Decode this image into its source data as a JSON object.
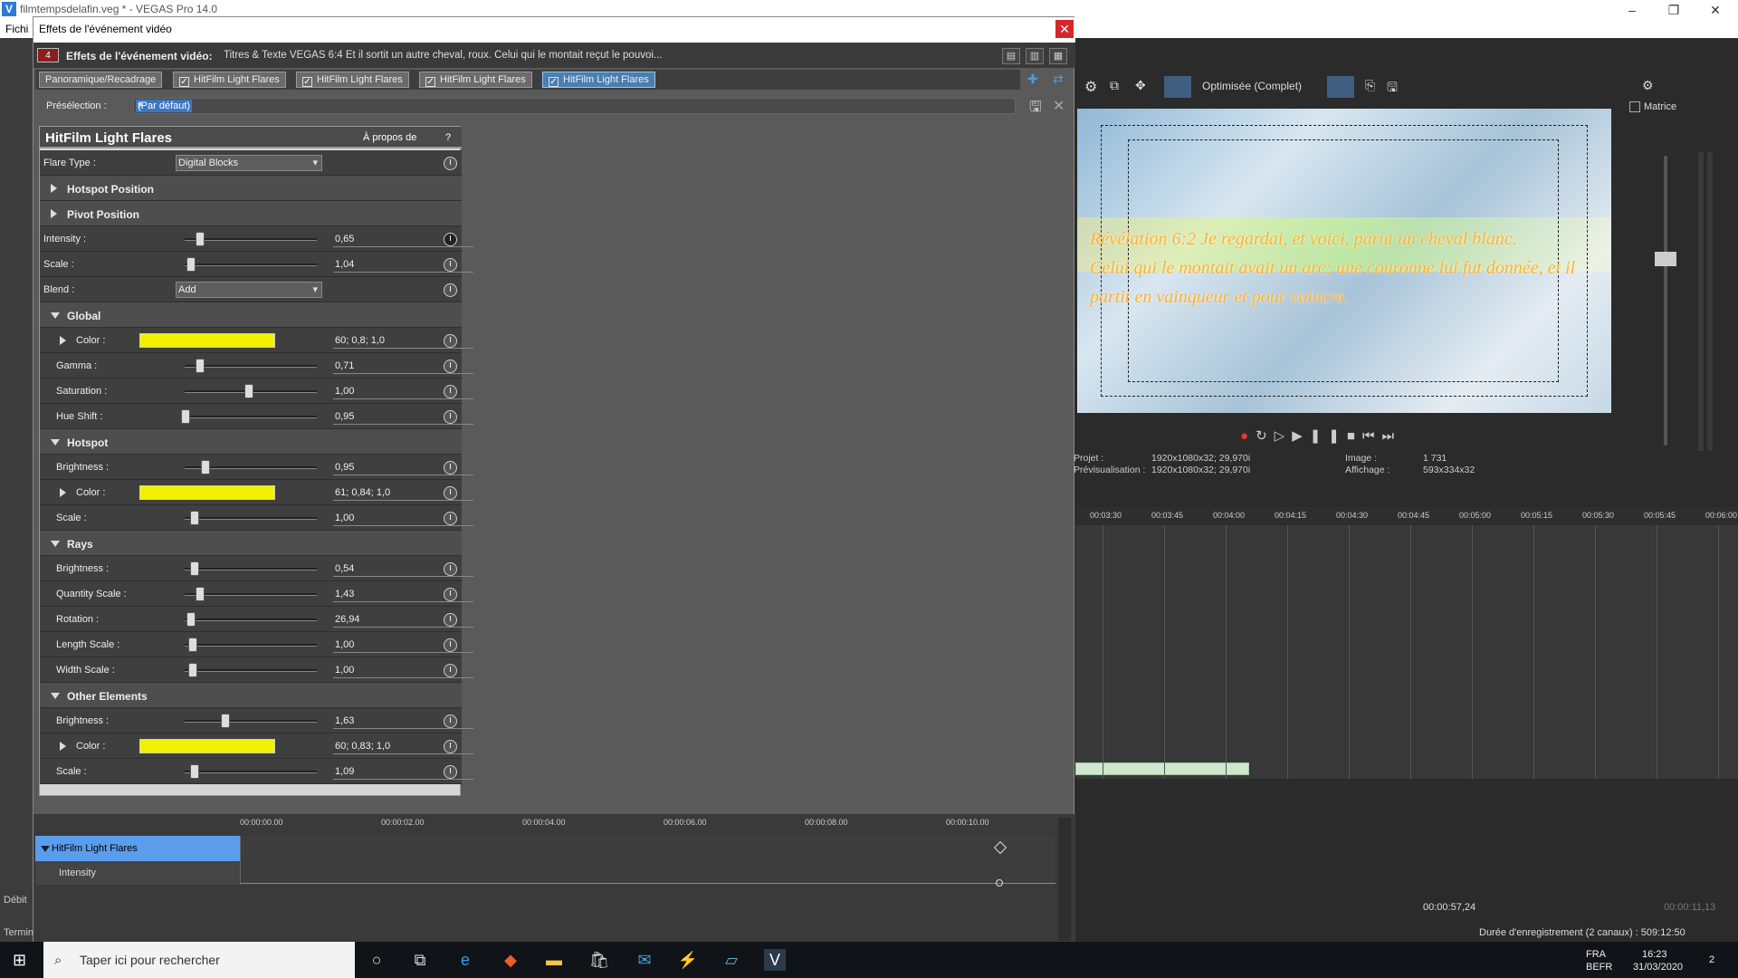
{
  "window": {
    "title": "filmtempsdelafin.veg * - VEGAS Pro 14.0",
    "menu_first": "Fichi"
  },
  "dialog": {
    "title": "Effets de l'événement vidéo",
    "fx_badge": "4",
    "header_label": "Effets de l'événement vidéo:",
    "header_desc": "Titres & Texte VEGAS 6:4 Et il sortit un autre cheval, roux. Celui qui le montait reçut le pouvoi...",
    "chain": [
      "Panoramique/Recadrage",
      "HitFilm Light Flares",
      "HitFilm Light Flares",
      "HitFilm Light Flares",
      "HitFilm Light Flares"
    ],
    "preset_label": "Présélection :",
    "preset_value": "(Par défaut)"
  },
  "plugin": {
    "title": "HitFilm Light Flares",
    "about": "À propos de",
    "help": "?",
    "flare_type_label": "Flare Type :",
    "flare_type_value": "Digital Blocks",
    "hotspot_position": "Hotspot Position",
    "pivot_position": "Pivot Position",
    "intensity_label": "Intensity :",
    "intensity_value": "0,65",
    "scale_label": "Scale :",
    "scale_value": "1,04",
    "blend_label": "Blend :",
    "blend_value": "Add",
    "global": {
      "title": "Global",
      "color_label": "Color :",
      "color_value": "60; 0,8; 1,0",
      "gamma_label": "Gamma :",
      "gamma_value": "0,71",
      "saturation_label": "Saturation :",
      "saturation_value": "1,00",
      "hue_label": "Hue Shift :",
      "hue_value": "0,95"
    },
    "hotspot": {
      "title": "Hotspot",
      "brightness_label": "Brightness :",
      "brightness_value": "0,95",
      "color_label": "Color :",
      "color_value": "61; 0,84; 1,0",
      "scale_label": "Scale :",
      "scale_value": "1,00"
    },
    "rays": {
      "title": "Rays",
      "brightness_label": "Brightness :",
      "brightness_value": "0,54",
      "quantity_label": "Quantity Scale :",
      "quantity_value": "1,43",
      "rotation_label": "Rotation :",
      "rotation_value": "26,94",
      "length_label": "Length Scale :",
      "length_value": "1,00",
      "width_label": "Width Scale :",
      "width_value": "1,00"
    },
    "other": {
      "title": "Other Elements",
      "brightness_label": "Brightness :",
      "brightness_value": "1,63",
      "color_label": "Color :",
      "color_value": "60; 0,83; 1,0",
      "scale_label": "Scale :",
      "scale_value": "1,09"
    },
    "swatch_color": "#f2f200"
  },
  "keyframes": {
    "ticks": [
      "00:00:00.00",
      "00:00:02.00",
      "00:00:04.00",
      "00:00:06.00",
      "00:00:08.00",
      "00:00:10.00"
    ],
    "track": "HitFilm Light Flares",
    "param": "Intensity"
  },
  "preview": {
    "quality": "Optimisée (Complet)",
    "verse": "Révélation 6:2 Je regardai, et voici, parut un cheval blanc.\nCelui qui le montait avait un arc; une couronne lui fut donnée, et il\npartit en vainqueur et pour vaincre.",
    "projet_label": "Projet :",
    "projet_value": "1920x1080x32; 29,970i",
    "previs_label": "Prévisualisation :",
    "previs_value": "1920x1080x32; 29,970i",
    "image_label": "Image :",
    "image_value": "1 731",
    "affichage_label": "Affichage :",
    "affichage_value": "593x334x32"
  },
  "master": {
    "label": "Matrice"
  },
  "timeline": {
    "ticks": [
      "00:03:30",
      "00:03:45",
      "00:04:00",
      "00:04:15",
      "00:04:30",
      "00:04:45",
      "00:05:00",
      "00:05:15",
      "00:05:30",
      "00:05:45",
      "00:06:00"
    ]
  },
  "status": {
    "timecode": "00:00:57,24",
    "timecode2": "00:00:11,13",
    "record": "Durée d'enregistrement (2 canaux) : 509:12:50",
    "debit": "Débit",
    "termin": "Termin"
  },
  "taskbar": {
    "search": "Taper ici pour rechercher",
    "lang1": "FRA",
    "lang2": "BEFR",
    "time": "16:23",
    "date": "31/03/2020",
    "notif": "2"
  }
}
